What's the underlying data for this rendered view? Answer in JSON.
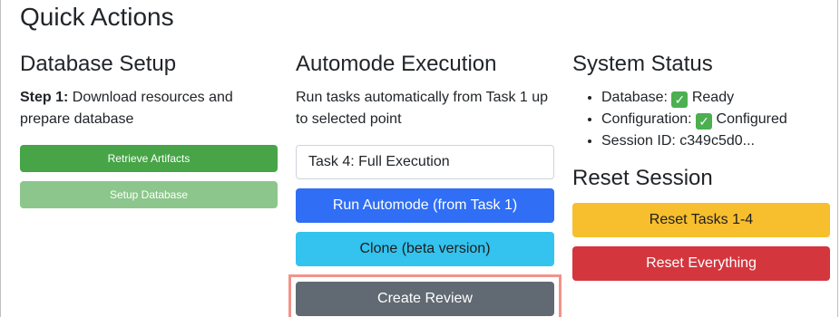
{
  "page": {
    "title": "Quick Actions"
  },
  "database_setup": {
    "title": "Database Setup",
    "step_label": "Step 1:",
    "step_text": " Download resources and prepare database",
    "retrieve_button": "Retrieve Artifacts",
    "setup_button": "Setup Database"
  },
  "automode": {
    "title": "Automode Execution",
    "description": "Run tasks automatically from Task 1 up to selected point",
    "selected_task": "Task 4: Full Execution",
    "run_button": "Run Automode (from Task 1)",
    "clone_button": "Clone (beta version)",
    "review_button": "Create Review"
  },
  "system_status": {
    "title": "System Status",
    "items": [
      {
        "label": "Database: ",
        "check": "✓",
        "value": " Ready"
      },
      {
        "label": "Configuration: ",
        "check": "✓",
        "value": " Configured"
      },
      {
        "label": "Session ID: c349c5d0...",
        "check": "",
        "value": ""
      }
    ]
  },
  "reset_session": {
    "title": "Reset Session",
    "reset_tasks_button": "Reset Tasks 1-4",
    "reset_everything_button": "Reset Everything"
  },
  "colors": {
    "green": "#47a447",
    "green_light": "#8cc68c",
    "blue": "#2f6ef5",
    "cyan": "#33c3ee",
    "gray": "#616a73",
    "yellow": "#f7be2e",
    "red": "#d4363e",
    "highlight": "#f2938a"
  }
}
